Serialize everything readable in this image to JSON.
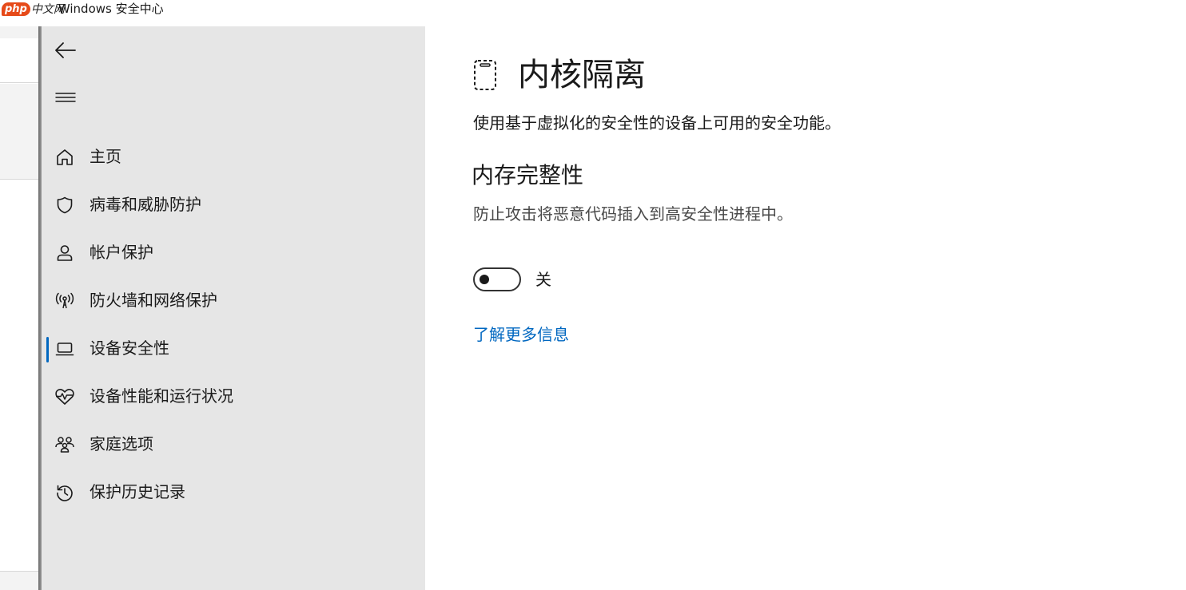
{
  "window": {
    "title": "Windows 安全中心",
    "watermark_logo": "php",
    "watermark_text": "中文网"
  },
  "sidebar": {
    "back_icon": "back-arrow-icon",
    "menu_icon": "hamburger-menu-icon",
    "items": [
      {
        "label": "主页",
        "icon": "home-icon",
        "active": false
      },
      {
        "label": "病毒和威胁防护",
        "icon": "shield-icon",
        "active": false
      },
      {
        "label": "帐户保护",
        "icon": "person-icon",
        "active": false
      },
      {
        "label": "防火墙和网络保护",
        "icon": "antenna-icon",
        "active": false
      },
      {
        "label": "设备安全性",
        "icon": "laptop-icon",
        "active": true
      },
      {
        "label": "设备性能和运行状况",
        "icon": "heart-pulse-icon",
        "active": false
      },
      {
        "label": "家庭选项",
        "icon": "family-icon",
        "active": false
      },
      {
        "label": "保护历史记录",
        "icon": "history-icon",
        "active": false
      }
    ]
  },
  "main": {
    "title": "内核隔离",
    "title_icon": "core-isolation-icon",
    "description": "使用基于虚拟化的安全性的设备上可用的安全功能。",
    "section": {
      "title": "内存完整性",
      "description": "防止攻击将恶意代码插入到高安全性进程中。",
      "toggle_on": false,
      "toggle_state_label": "关"
    },
    "learn_more": "了解更多信息"
  },
  "colors": {
    "sidebar_bg": "#e6e6e6",
    "accent": "#0067c0",
    "text": "#1a1a1a"
  }
}
